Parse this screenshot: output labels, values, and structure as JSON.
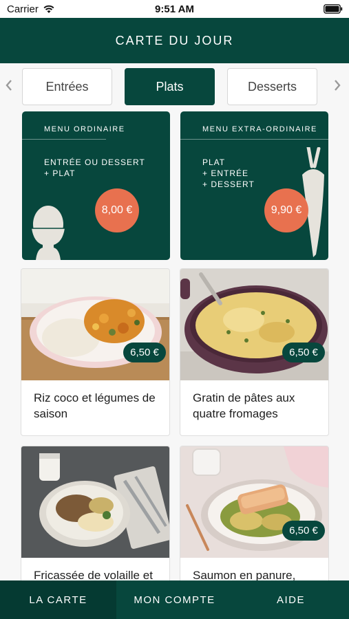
{
  "status_bar": {
    "carrier": "Carrier",
    "time": "9:51 AM"
  },
  "header": {
    "title": "CARTE DU JOUR"
  },
  "tabs": [
    {
      "label": "Entrées",
      "selected": false
    },
    {
      "label": "Plats",
      "selected": true
    },
    {
      "label": "Desserts",
      "selected": false
    }
  ],
  "menus": [
    {
      "title": "MENU ORDINAIRE",
      "lines": [
        "ENTRÉE OU DESSERT",
        "+ PLAT"
      ],
      "price": "8,00 €",
      "icon": "egg-icon"
    },
    {
      "title": "MENU EXTRA-ORDINAIRE",
      "lines": [
        "PLAT",
        "+ ENTRÉE",
        "+ DESSERT"
      ],
      "price": "9,90 €",
      "icon": "carrot-icon"
    }
  ],
  "products": [
    {
      "name": "Riz coco et légumes de saison",
      "price": "6,50 €"
    },
    {
      "name": "Gratin de pâtes aux quatre fromages",
      "price": "6,50 €"
    },
    {
      "name": "Fricassée de volaille et",
      "price": ""
    },
    {
      "name": "Saumon en panure,",
      "price": "6,50 €"
    }
  ],
  "nav": {
    "items": [
      {
        "label": "LA CARTE",
        "active": true
      },
      {
        "label": "MON COMPTE",
        "active": false
      },
      {
        "label": "AIDE",
        "active": false
      }
    ]
  },
  "colors": {
    "brand_green": "#07473d",
    "price_orange": "#e8714f",
    "background": "#f7f7f7"
  }
}
